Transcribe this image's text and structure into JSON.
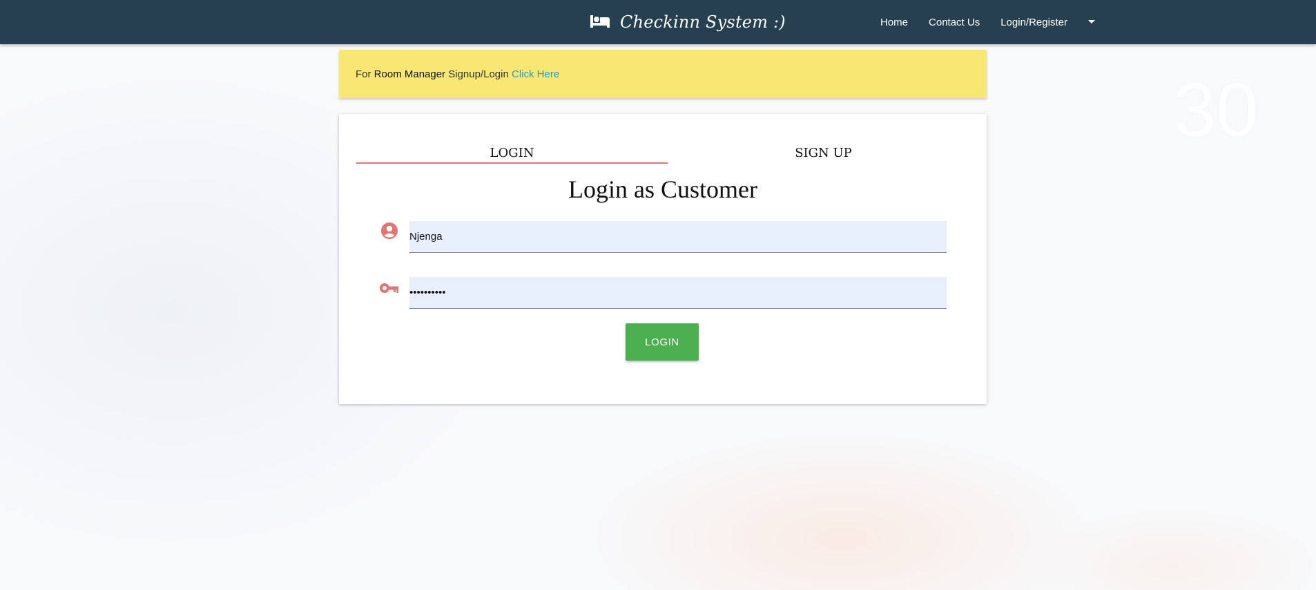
{
  "app": {
    "brand_title": "Checkinn System :)",
    "brand_icon": "bed-icon"
  },
  "nav": {
    "links": [
      "Home",
      "Contact Us",
      "Login/Register"
    ],
    "dropdown_icon": "caret-down-icon",
    "bar_color": "#26404f"
  },
  "alert": {
    "prefix": "For",
    "role": "Room Manager",
    "suffix": "Signup/Login",
    "link": "Click Here",
    "color": "#f8e873"
  },
  "tabs": [
    {
      "label": "Login",
      "active": true
    },
    {
      "label": "Sign Up",
      "active": false
    }
  ],
  "form": {
    "heading": "Login as Customer",
    "username": {
      "value": "Njenga",
      "icon": "account-circle-icon"
    },
    "password": {
      "value": "Njenga1234",
      "icon": "key-icon"
    },
    "submit_label": "Login",
    "accent_color": "#e57373",
    "button_color": "#4caf50"
  }
}
